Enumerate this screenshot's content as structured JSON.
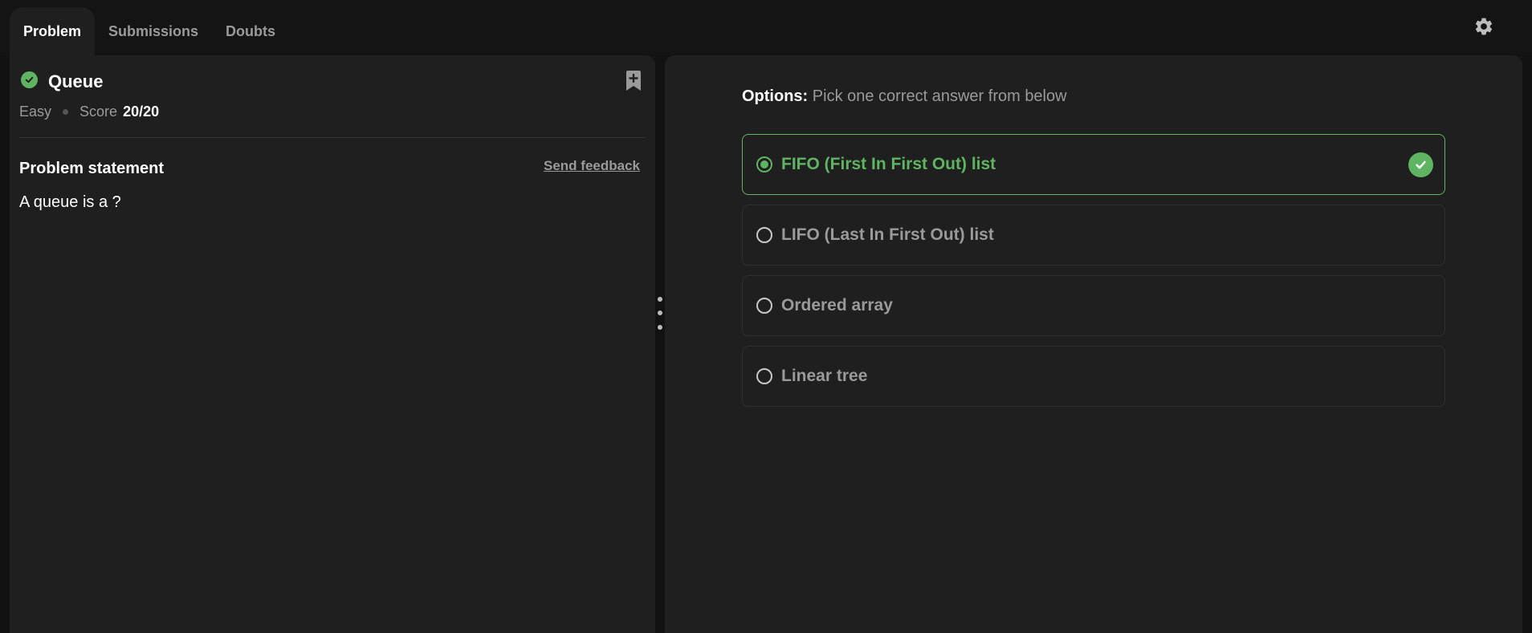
{
  "tabs": [
    {
      "label": "Problem",
      "active": true
    },
    {
      "label": "Submissions",
      "active": false
    },
    {
      "label": "Doubts",
      "active": false
    }
  ],
  "problem": {
    "title": "Queue",
    "difficulty": "Easy",
    "score_label": "Score",
    "score_value": "20/20",
    "statement_heading": "Problem statement",
    "feedback_link": "Send feedback",
    "question": "A queue is a ?"
  },
  "options_panel": {
    "heading": "Options:",
    "instruction": "Pick one correct answer from below",
    "options": [
      {
        "label": "FIFO (First In First Out) list",
        "selected": true,
        "correct": true
      },
      {
        "label": "LIFO (Last In First Out) list",
        "selected": false,
        "correct": false
      },
      {
        "label": "Ordered array",
        "selected": false,
        "correct": false
      },
      {
        "label": "Linear tree",
        "selected": false,
        "correct": false
      }
    ]
  },
  "icons": {
    "settings": "gear-icon",
    "status": "check-circle-icon",
    "bookmark": "bookmark-add-icon",
    "resizer": "drag-handle-icon"
  },
  "colors": {
    "accent_green": "#5fb462",
    "background": "#121212",
    "panel": "#1f1f1f"
  }
}
